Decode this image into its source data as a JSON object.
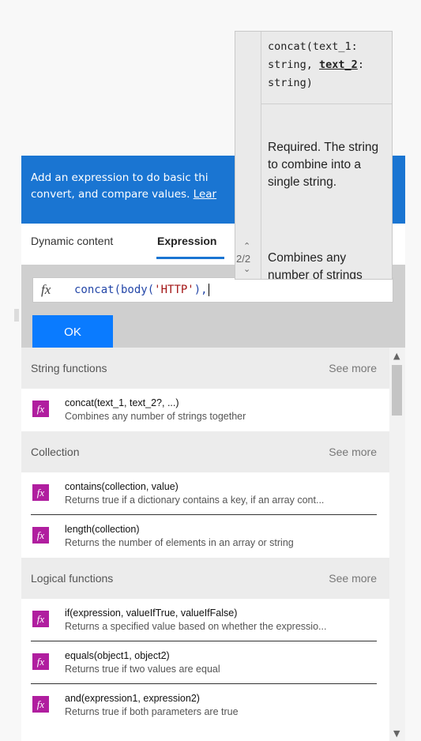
{
  "banner": {
    "line1": "Add an expression to do basic thi",
    "line2": "convert, and compare values. ",
    "link": "Lear"
  },
  "tabs": [
    {
      "label": "Dynamic content",
      "active": false
    },
    {
      "label": "Expression",
      "active": true
    }
  ],
  "expression": {
    "fx": "fx",
    "before": "concat(body(",
    "string": "'HTTP'",
    "after": "),"
  },
  "ok_label": "OK",
  "sections": [
    {
      "title": "String functions",
      "see_more": "See more",
      "items": [
        {
          "name": "concat(text_1, text_2?, ...)",
          "desc": "Combines any number of strings together"
        }
      ]
    },
    {
      "title": "Collection",
      "see_more": "See more",
      "items": [
        {
          "name": "contains(collection, value)",
          "desc": "Returns true if a dictionary contains a key, if an array cont..."
        },
        {
          "name": "length(collection)",
          "desc": "Returns the number of elements in an array or string"
        }
      ]
    },
    {
      "title": "Logical functions",
      "see_more": "See more",
      "items": [
        {
          "name": "if(expression, valueIfTrue, valueIfFalse)",
          "desc": "Returns a specified value based on whether the expressio..."
        },
        {
          "name": "equals(object1, object2)",
          "desc": "Returns true if two values are equal"
        },
        {
          "name": "and(expression1, expression2)",
          "desc": "Returns true if both parameters are true"
        }
      ]
    }
  ],
  "tooltip": {
    "sig_part1": "concat(text_1: string, ",
    "sig_current": "text_2",
    "sig_part2": ": string)",
    "param_desc": "Required. The string to combine into a single string.",
    "count": "2/2",
    "fn_desc": "Combines any number of strings together"
  },
  "icons": {
    "function": "fx-icon",
    "scroll_up": "chevron-up-icon",
    "scroll_down": "chevron-down-icon"
  },
  "colors": {
    "banner": "#1a75d2",
    "ok_button": "#0a7bff",
    "fn_icon": "#b01e9f",
    "string_literal": "#a31515",
    "code": "#2447a8"
  }
}
